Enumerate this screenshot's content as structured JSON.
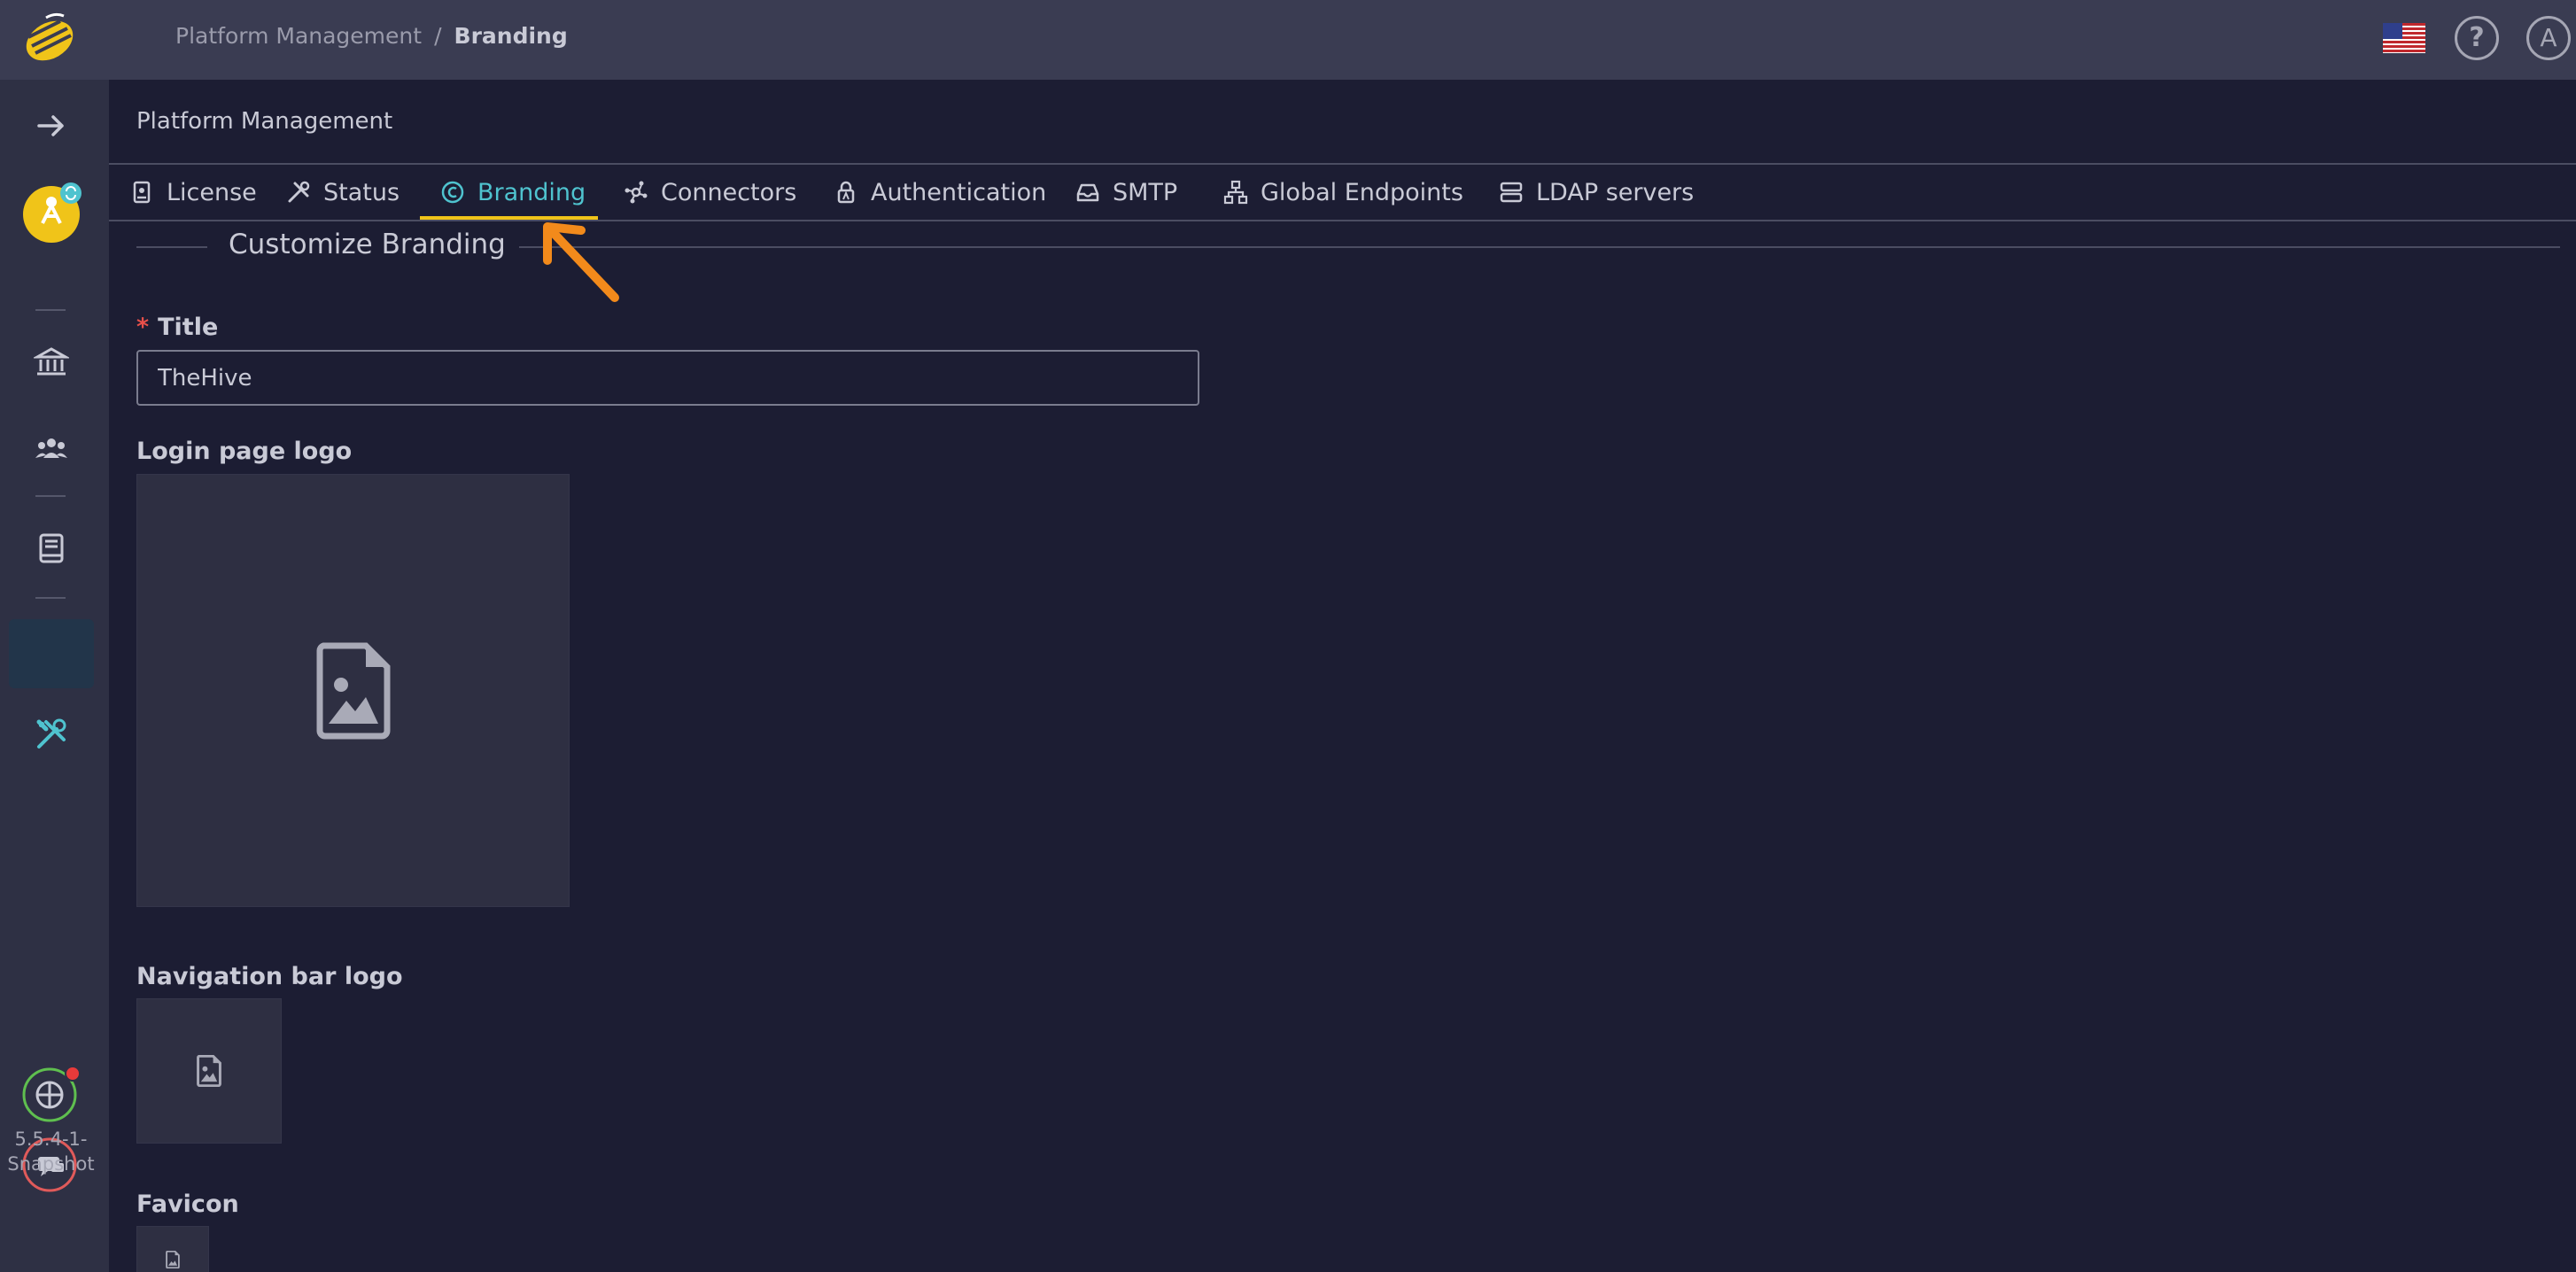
{
  "topbar": {
    "breadcrumb_parent": "Platform Management",
    "breadcrumb_separator": "/",
    "breadcrumb_current": "Branding",
    "help_glyph": "?",
    "avatar_letter": "A"
  },
  "sidebar": {
    "version": "5.5.4-1-\nSnapshot"
  },
  "page": {
    "heading": "Platform Management"
  },
  "tabs": [
    {
      "label": "License",
      "icon": "id-badge-icon"
    },
    {
      "label": "Status",
      "icon": "tools-icon"
    },
    {
      "label": "Branding",
      "icon": "copyright-icon",
      "active": true
    },
    {
      "label": "Connectors",
      "icon": "network-icon"
    },
    {
      "label": "Authentication",
      "icon": "lock-icon"
    },
    {
      "label": "SMTP",
      "icon": "inbox-icon"
    },
    {
      "label": "Global Endpoints",
      "icon": "sitemap-icon"
    },
    {
      "label": "LDAP servers",
      "icon": "server-icon"
    }
  ],
  "form": {
    "section_title": "Customize Branding",
    "title_label": "Title",
    "title_required_mark": "*",
    "title_value": "TheHive",
    "login_logo_label": "Login page logo",
    "navbar_logo_label": "Navigation bar logo",
    "favicon_label": "Favicon"
  },
  "colors": {
    "accent": "#4fc3cf",
    "tab_underline": "#f0c419",
    "annotation_arrow": "#f28a1b",
    "background": "#1c1d33",
    "topbar": "#3a3c52",
    "sidebar": "#2e3044"
  }
}
